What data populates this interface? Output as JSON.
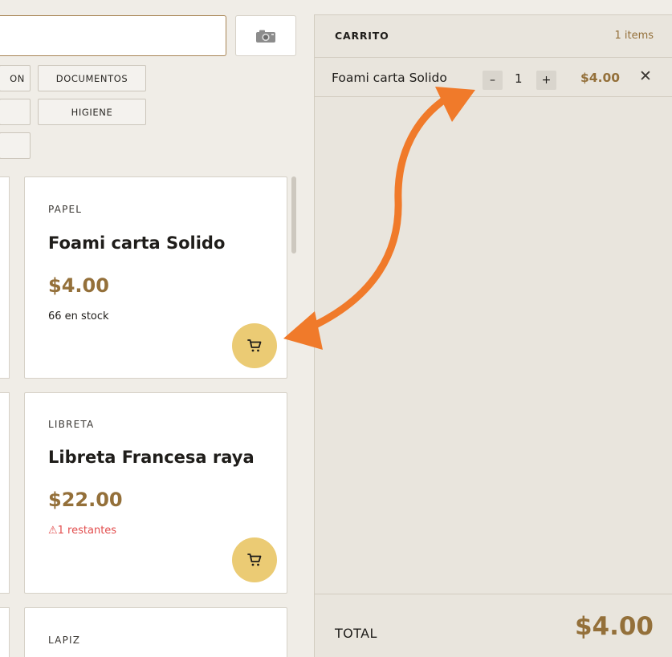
{
  "search": {
    "value": "",
    "placeholder": ""
  },
  "camera": {
    "icon": "camera-icon"
  },
  "categories": [
    {
      "label": "ON"
    },
    {
      "label": "DOCUMENTOS"
    },
    {
      "label": ""
    },
    {
      "label": "HIGIENE"
    },
    {
      "label": ""
    }
  ],
  "products": [
    {
      "category": "PAPEL",
      "name": "Foami carta Solido",
      "price": "$4.00",
      "stock": "66 en stock"
    },
    {
      "category": "LIBRETA",
      "name": "Libreta Francesa raya",
      "price": "$22.00",
      "stock": "⚠1 restantes"
    },
    {
      "category": "LAPIZ"
    }
  ],
  "cart": {
    "title": "CARRITO",
    "count": "1 items",
    "items": [
      {
        "name": "Foami carta Solido",
        "minus": "–",
        "qty": "1",
        "plus": "+",
        "price": "$4.00",
        "remove": "✕"
      }
    ],
    "total_label": "TOTAL",
    "total_value": "$4.00"
  },
  "colors": {
    "accent": "#94703a",
    "add_button": "#ebcb74",
    "annotation_arrow": "#f07a2a",
    "warning": "#e24d4d"
  }
}
